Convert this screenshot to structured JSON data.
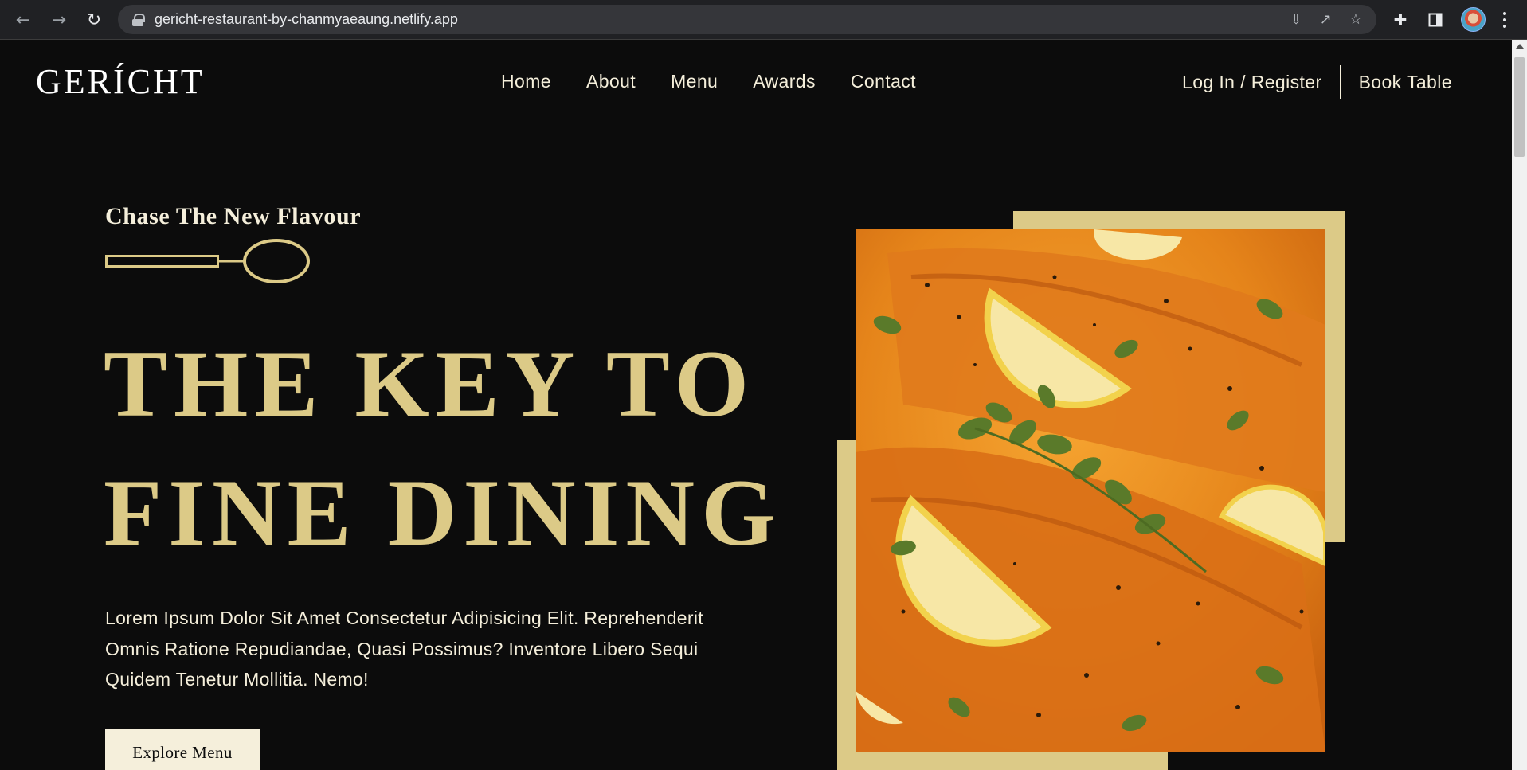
{
  "browser": {
    "url": "gericht-restaurant-by-chanmyaeaung.netlify.app",
    "back_icon": "arrow-left-icon",
    "forward_icon": "arrow-right-icon",
    "reload_icon": "reload-icon"
  },
  "site": {
    "logo": "GERÍCHT",
    "nav": [
      "Home",
      "About",
      "Menu",
      "Awards",
      "Contact"
    ],
    "login": "Log In / Register",
    "book": "Book Table"
  },
  "hero": {
    "subtitle": "Chase The New Flavour",
    "headline_line1": "THE KEY TO",
    "headline_line2": "FINE DINING",
    "body": "Lorem Ipsum Dolor Sit Amet Consectetur Adipisicing Elit. Reprehenderit Omnis Ratione Repudiandae, Quasi Possimus? Inventore Libero Sequi Quidem Tenetur Mollitia. Nemo!",
    "cta": "Explore Menu"
  },
  "colors": {
    "background": "#0c0c0c",
    "gold": "#dcca87",
    "cream": "#f5efdb"
  }
}
